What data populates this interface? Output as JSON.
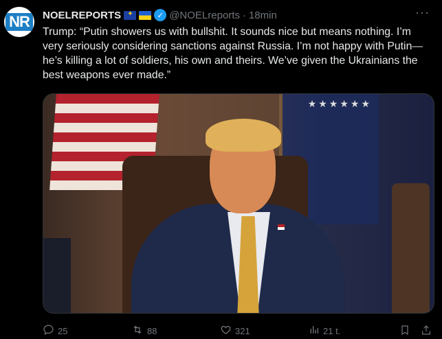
{
  "author": {
    "name": "NOELREPORTS",
    "avatar_text": "NR",
    "handle": "@NOELreports",
    "separator": "·",
    "time": "18min",
    "verified_icon": "verified-badge-icon"
  },
  "more_label": "···",
  "text": "Trump: “Putin showers us with bullshit. It sounds nice but means nothing. I’m very seriously considering sanctions against Russia. I’m not happy with Putin—he’s killing a lot of soldiers, his own and theirs. We’ve given the Ukrainians the best weapons ever made.”",
  "media": {
    "stars": "★★★★★★"
  },
  "actions": {
    "replies": "25",
    "reposts": "88",
    "likes": "321",
    "views": "21 t."
  },
  "colors": {
    "accent": "#1d9bf0",
    "muted": "#71767b",
    "text": "#e7e9ea",
    "background": "#000000"
  }
}
